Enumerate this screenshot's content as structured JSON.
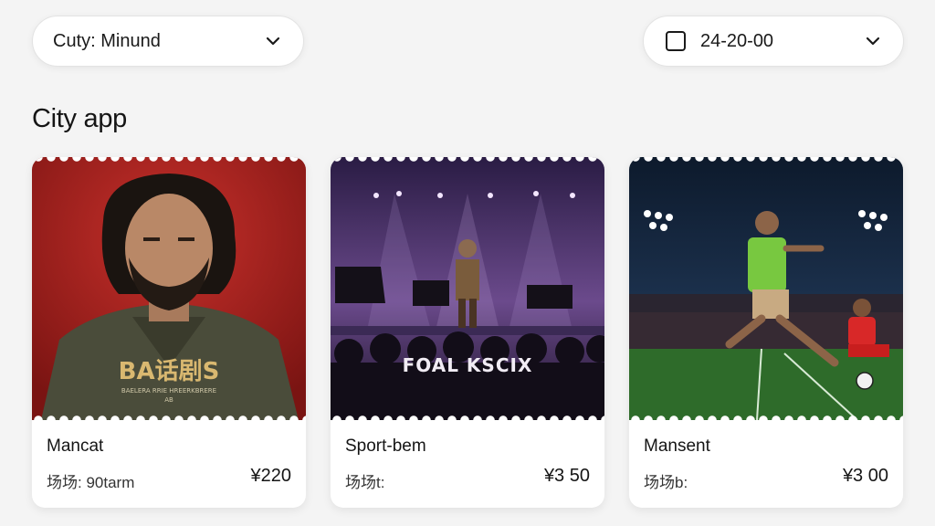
{
  "filters": {
    "city_label": "Cuty: Minund",
    "date_label": "24-20-00"
  },
  "section": {
    "title": "City app"
  },
  "events": [
    {
      "poster_text": "BA话剧S",
      "poster_subtext": "BAELERA RRIE HREERKBRERE",
      "poster_subtext2": "AB",
      "name": "Mancat",
      "venue": "场场:  90tarm",
      "price": "¥220"
    },
    {
      "poster_text": "FOAL KSCIX",
      "name": "Sport-bem",
      "venue": "场场t:",
      "price": "¥3 50"
    },
    {
      "name": "Mansent",
      "venue": "场场b:",
      "price": "¥3 00"
    }
  ],
  "colors": {
    "background": "#f4f4f4",
    "card": "#ffffff",
    "poster1_bg": "#b3201f",
    "poster2_bg": "#3a2456",
    "poster3_bg": "#0f1f33"
  },
  "icons": {
    "city_chevron": "chevron-down-icon",
    "date_checkbox": "checkbox-icon",
    "date_chevron": "chevron-down-icon"
  }
}
